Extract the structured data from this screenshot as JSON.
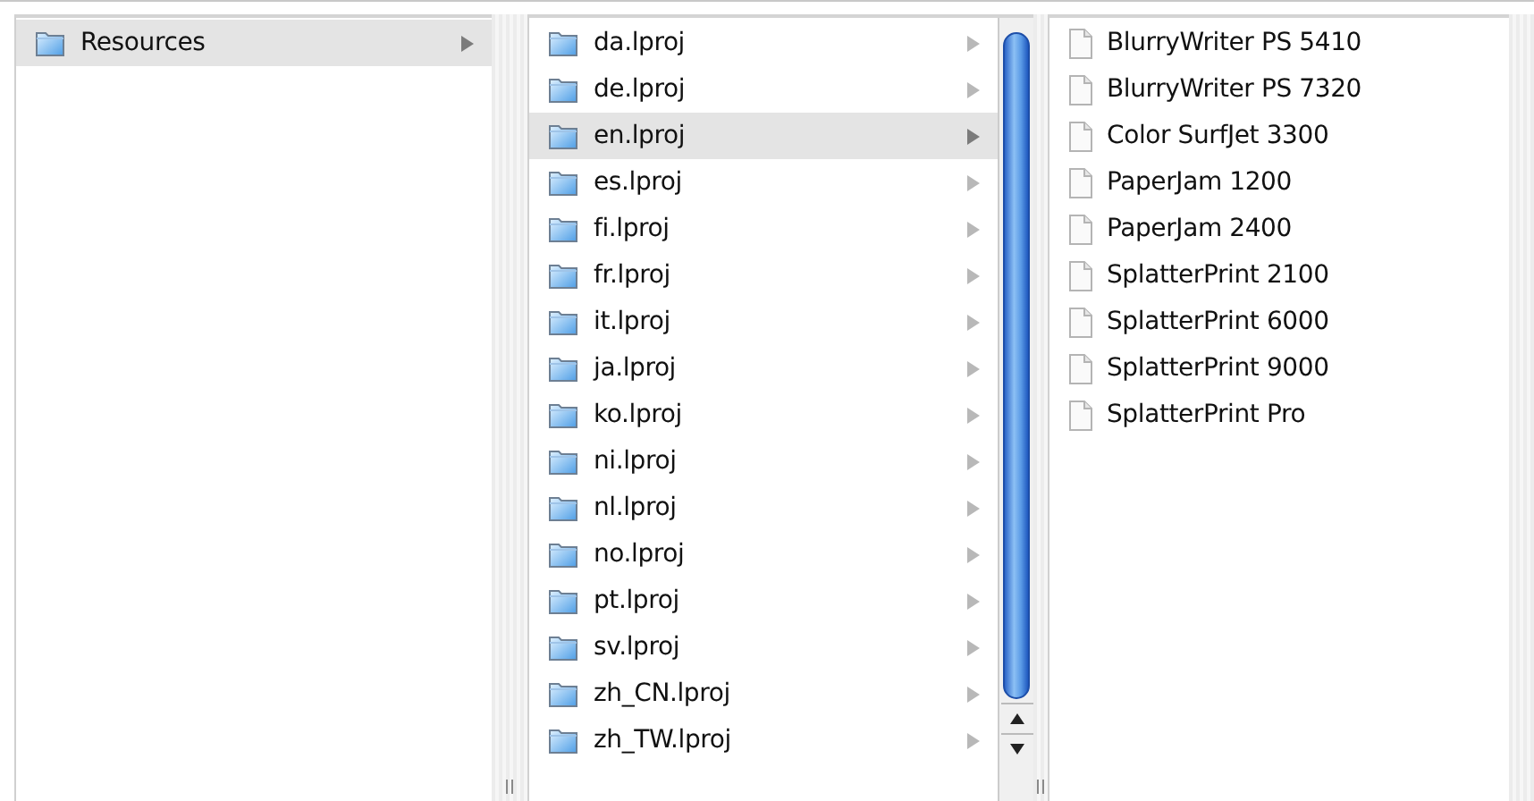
{
  "columns": [
    {
      "scrollbar": false,
      "items": [
        {
          "name": "Resources",
          "kind": "folder",
          "selected": true
        }
      ]
    },
    {
      "scrollbar": true,
      "items": [
        {
          "name": "da.lproj",
          "kind": "folder",
          "selected": false
        },
        {
          "name": "de.lproj",
          "kind": "folder",
          "selected": false
        },
        {
          "name": "en.lproj",
          "kind": "folder",
          "selected": true
        },
        {
          "name": "es.lproj",
          "kind": "folder",
          "selected": false
        },
        {
          "name": "fi.lproj",
          "kind": "folder",
          "selected": false
        },
        {
          "name": "fr.lproj",
          "kind": "folder",
          "selected": false
        },
        {
          "name": "it.lproj",
          "kind": "folder",
          "selected": false
        },
        {
          "name": "ja.lproj",
          "kind": "folder",
          "selected": false
        },
        {
          "name": "ko.lproj",
          "kind": "folder",
          "selected": false
        },
        {
          "name": "ni.lproj",
          "kind": "folder",
          "selected": false
        },
        {
          "name": "nl.lproj",
          "kind": "folder",
          "selected": false
        },
        {
          "name": "no.lproj",
          "kind": "folder",
          "selected": false
        },
        {
          "name": "pt.lproj",
          "kind": "folder",
          "selected": false
        },
        {
          "name": "sv.lproj",
          "kind": "folder",
          "selected": false
        },
        {
          "name": "zh_CN.lproj",
          "kind": "folder",
          "selected": false
        },
        {
          "name": "zh_TW.lproj",
          "kind": "folder",
          "selected": false
        }
      ]
    },
    {
      "scrollbar": false,
      "items": [
        {
          "name": "BlurryWriter PS 5410",
          "kind": "file",
          "selected": false
        },
        {
          "name": "BlurryWriter PS 7320",
          "kind": "file",
          "selected": false
        },
        {
          "name": "Color SurfJet 3300",
          "kind": "file",
          "selected": false
        },
        {
          "name": "PaperJam 1200",
          "kind": "file",
          "selected": false
        },
        {
          "name": "PaperJam 2400",
          "kind": "file",
          "selected": false
        },
        {
          "name": "SplatterPrint 2100",
          "kind": "file",
          "selected": false
        },
        {
          "name": "SplatterPrint 6000",
          "kind": "file",
          "selected": false
        },
        {
          "name": "SplatterPrint 9000",
          "kind": "file",
          "selected": false
        },
        {
          "name": "SplatterPrint Pro",
          "kind": "file",
          "selected": false
        }
      ]
    }
  ]
}
